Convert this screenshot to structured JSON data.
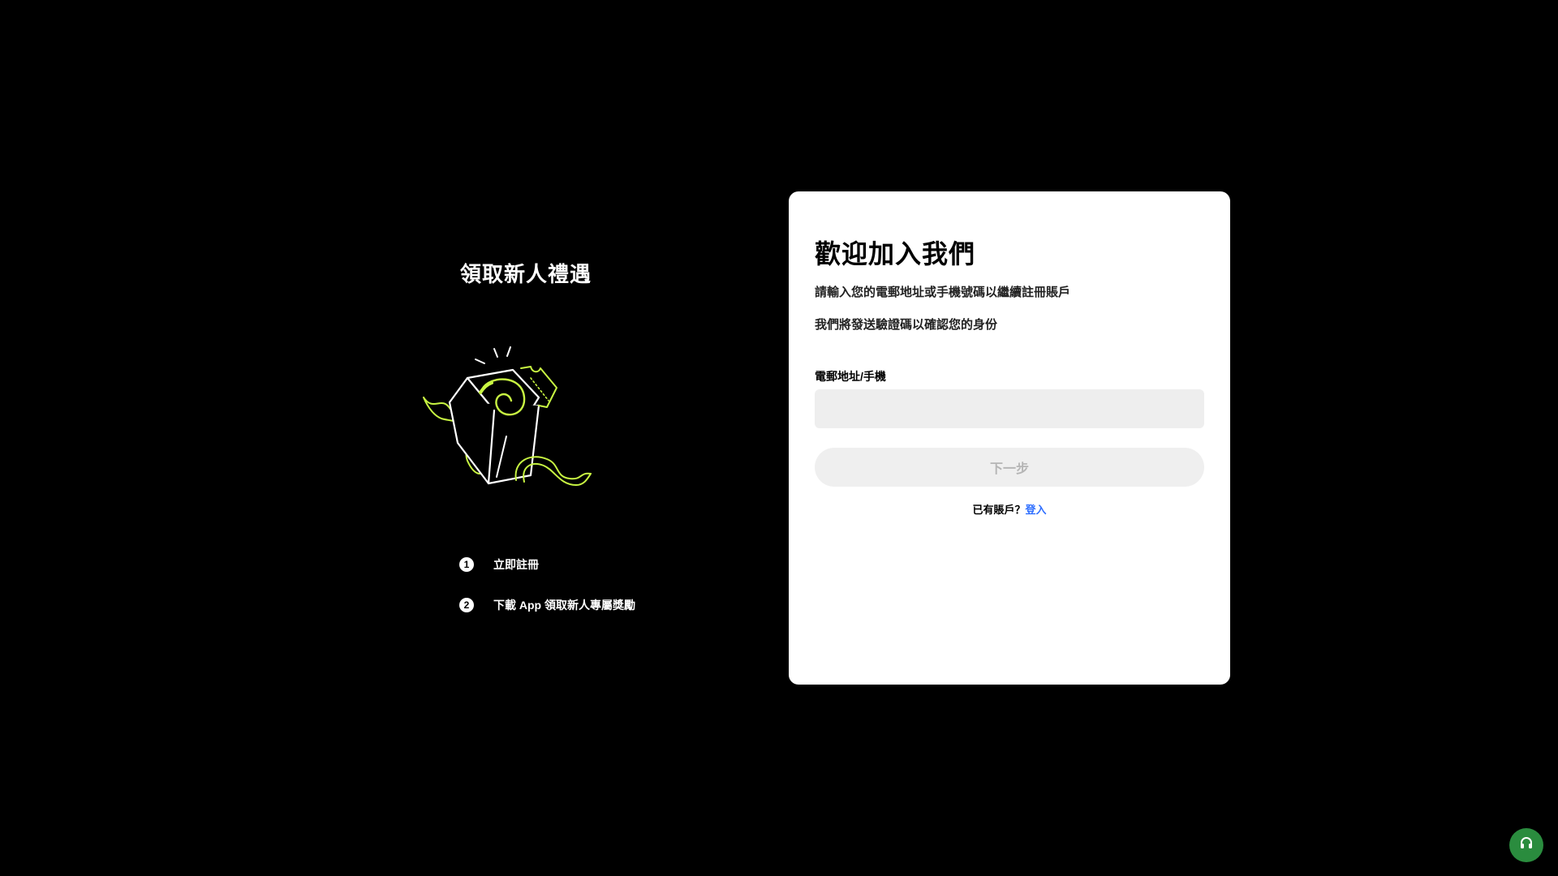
{
  "promo": {
    "title": "領取新人禮遇",
    "gift_icon": "gift-box-illustration",
    "steps": [
      {
        "num": "1",
        "text": "立即註冊"
      },
      {
        "num": "2",
        "text": "下載 App 領取新人專屬獎勵"
      }
    ]
  },
  "card": {
    "title": "歡迎加入我們",
    "desc_1": "請輸入您的電郵地址或手機號碼以繼續註冊賬戶",
    "desc_2": "我們將發送驗證碼以確認您的身份",
    "field_label": "電郵地址/手機",
    "input": {
      "value": "",
      "placeholder": ""
    },
    "submit_label": "下一步",
    "login_prompt": "已有賬戶？",
    "login_link": "登入"
  },
  "support": {
    "icon": "headset-icon"
  },
  "colors": {
    "background": "#000000",
    "card": "#ffffff",
    "accent_green": "#c8f542",
    "link_blue": "#2f6fff",
    "support_green": "#2a8c3e"
  }
}
